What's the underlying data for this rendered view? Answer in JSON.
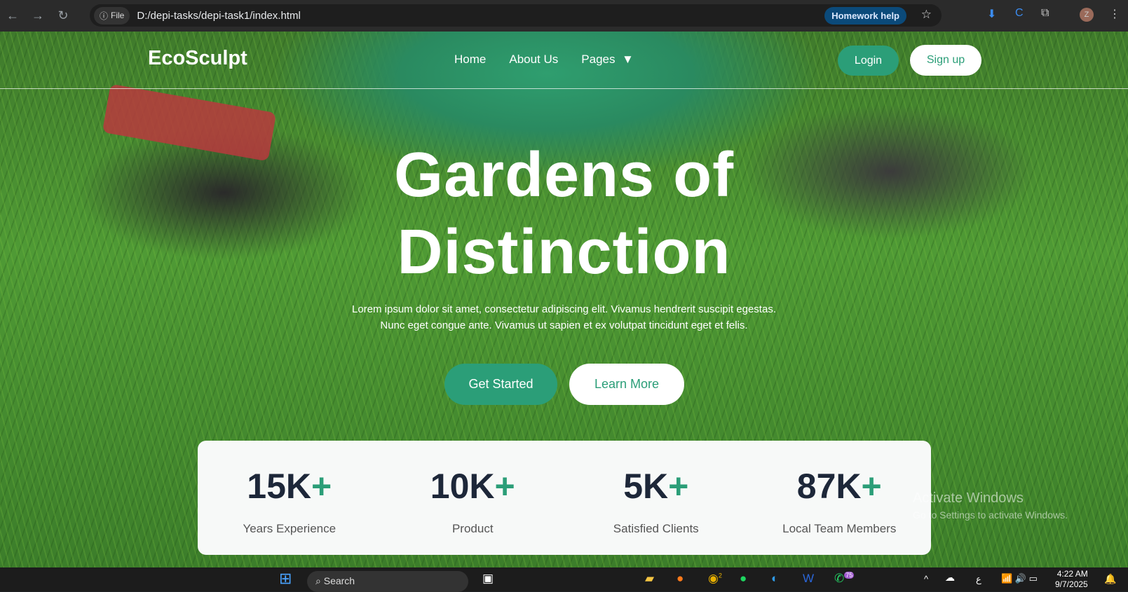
{
  "browser": {
    "chip": "File",
    "url": "D:/depi-tasks/depi-task1/index.html",
    "homework": "Homework help",
    "profile": "Z"
  },
  "nav": {
    "logo": "EcoSculpt",
    "links": [
      "Home",
      "About Us",
      "Pages"
    ],
    "dropdown_arrow": "▼",
    "login": "Login",
    "signup": "Sign up"
  },
  "hero": {
    "title_line1": "Gardens of",
    "title_line2": "Distinction",
    "lead_line1": "Lorem ipsum dolor sit amet, consectetur adipiscing elit. Vivamus hendrerit suscipit egestas.",
    "lead_line2": "Nunc eget congue ante. Vivamus ut sapien et ex volutpat tincidunt eget et felis.",
    "get_started": "Get Started",
    "learn_more": "Learn More"
  },
  "stats": [
    {
      "value": "15K",
      "plus": "+",
      "label": "Years Experience"
    },
    {
      "value": "10K",
      "plus": "+",
      "label": "Product"
    },
    {
      "value": "5K",
      "plus": "+",
      "label": "Satisfied Clients"
    },
    {
      "value": "87K",
      "plus": "+",
      "label": "Local Team Members"
    }
  ],
  "watermark": {
    "line1": "Activate Windows",
    "line2": "Go to Settings to activate Windows."
  },
  "taskbar": {
    "search": "Search",
    "time": "4:22 AM",
    "date": "9/7/2025",
    "chrome_badge": "2",
    "whatsapp_badge": "75",
    "lang": "ع"
  },
  "colors": {
    "accent": "#2b9e78",
    "dark": "#1d2739"
  }
}
